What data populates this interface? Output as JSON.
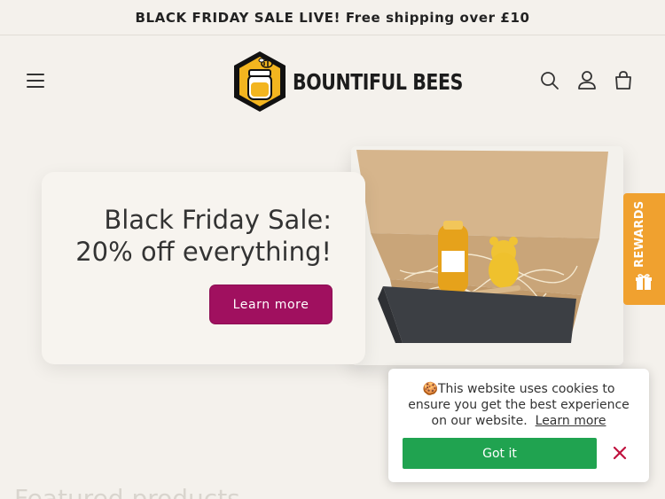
{
  "announcement": {
    "text": "BLACK FRIDAY SALE LIVE! Free shipping over £10"
  },
  "header": {
    "logo_text": "BOUNTIFUL BEES",
    "icons": {
      "menu": "menu-icon",
      "search": "search-icon",
      "account": "account-icon",
      "cart": "cart-icon"
    }
  },
  "hero": {
    "title_line1": "Black Friday Sale:",
    "title_line2": "20% off everything!",
    "cta_label": "Learn more"
  },
  "rewards": {
    "label": "REWARDS",
    "icon": "gift-icon",
    "color": "#f0a12f"
  },
  "cookie": {
    "emoji": "🍪",
    "message": "This website uses cookies to ensure you get the best experience on our website.",
    "link_label": "Learn more",
    "accept_label": "Got it",
    "accept_color": "#20a350",
    "close_color": "#c0133f"
  },
  "featured": {
    "heading": "Featured products"
  },
  "colors": {
    "background": "#f4f1ec",
    "accent": "#a0105f"
  }
}
